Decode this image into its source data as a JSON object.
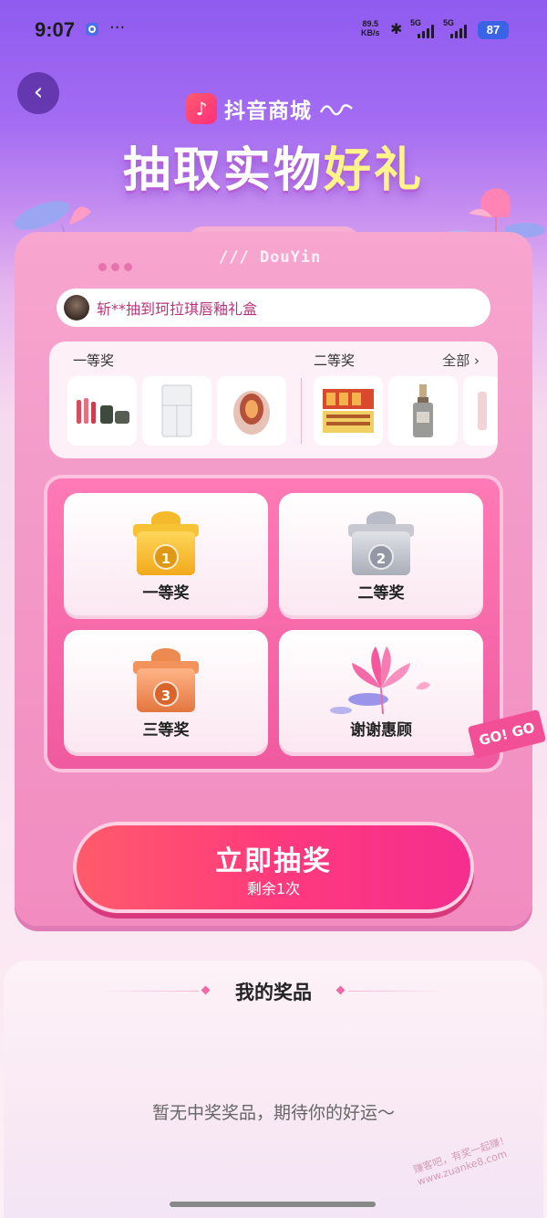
{
  "status": {
    "time": "9:07",
    "speed_value": "89.5",
    "speed_unit": "KB/s",
    "sig1": "5G",
    "sig2": "5G",
    "battery": "87"
  },
  "header": {
    "brand": "抖音商城",
    "brand_logo": "♪",
    "headline_a": "抽取实物",
    "headline_b": "好礼"
  },
  "card": {
    "tab_text": "/// DouYin",
    "ticker": "斩**抽到珂拉琪唇釉礼盒",
    "strip": {
      "first_label": "一等奖",
      "second_label": "二等奖",
      "all_label": "全部 ›"
    },
    "tiles": [
      "一等奖",
      "二等奖",
      "三等奖",
      "谢谢惠顾"
    ],
    "medals": [
      "1",
      "2",
      "3"
    ],
    "go_badge": "GO! GO"
  },
  "draw": {
    "main": "立即抽奖",
    "sub": "剩余1次"
  },
  "prizes": {
    "title": "我的奖品",
    "empty": "暂无中奖奖品，期待你的好运～"
  },
  "watermark": "赚客吧，有奖一起赚！www.zuanke8.com",
  "colors": {
    "accent": "#ff3a7c",
    "gold": "#f7c234",
    "silver": "#c7c9d1",
    "bronze": "#f2935c"
  }
}
